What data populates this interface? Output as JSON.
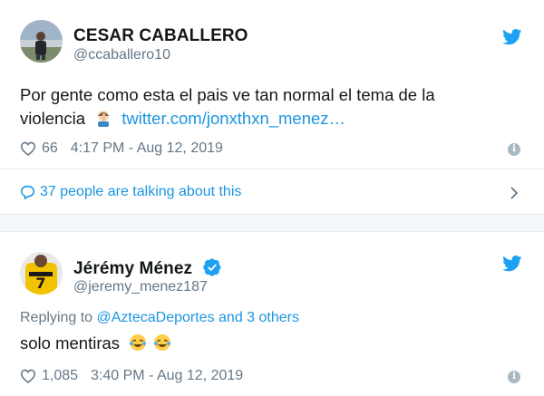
{
  "tweets": [
    {
      "name": "CESAR CABALLERO",
      "handle": "@ccaballero10",
      "text_line1": "Por gente como esta el pais ve tan normal el tema de la",
      "text_line2": "violencia",
      "link": "twitter.com/jonxthxn_menez…",
      "likes": "66",
      "timestamp": "4:17 PM - Aug 12, 2019",
      "talking": "37 people are talking about this"
    },
    {
      "name": "Jérémy Ménez",
      "handle": "@jeremy_menez187",
      "replying_prefix": "Replying to",
      "replying_mention": "@AztecaDeportes",
      "replying_suffix": "and 3 others",
      "text": "solo mentiras",
      "likes": "1,085",
      "timestamp": "3:40 PM - Aug 12, 2019"
    }
  ],
  "colors": {
    "accent": "#1b95e0",
    "muted": "#657786",
    "divider": "#e6ecf0"
  },
  "icons": [
    "twitter-bird-icon",
    "heart-icon",
    "info-icon",
    "speech-bubble-icon",
    "chevron-right-icon",
    "verified-badge-icon",
    "facepalm-emoji",
    "tears-of-joy-emoji"
  ]
}
